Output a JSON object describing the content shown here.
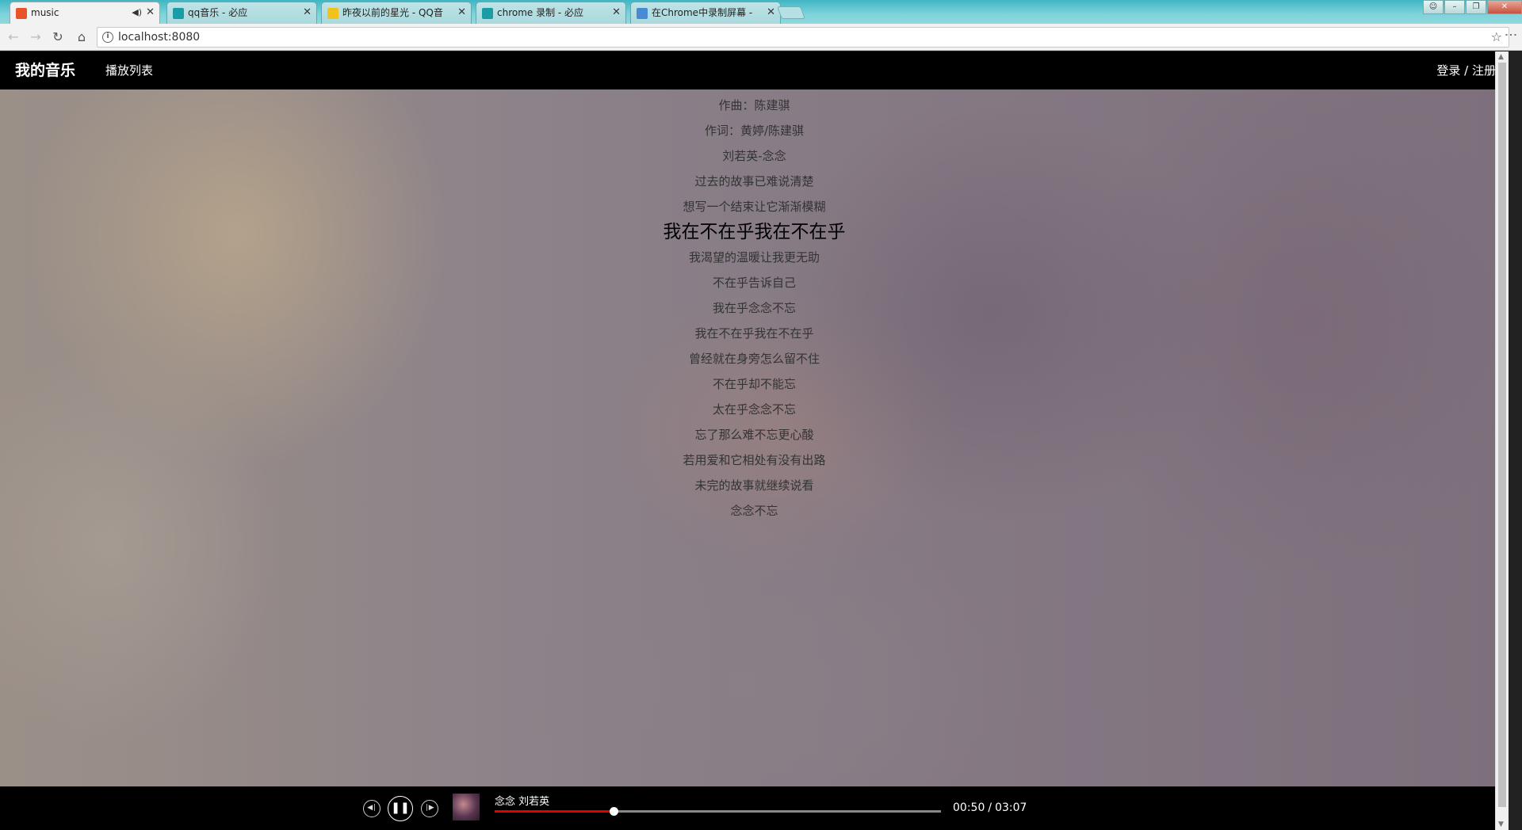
{
  "browser": {
    "tabs": [
      {
        "title": "music",
        "icon": "xampp-icon",
        "icon_color": "#e8532a",
        "active": true,
        "audio": true
      },
      {
        "title": "qq音乐 - 必应",
        "icon": "bing-icon",
        "icon_color": "#1a9ca6"
      },
      {
        "title": "昨夜以前的星光 - QQ音",
        "icon": "qqmusic-icon",
        "icon_color": "#f1c21b"
      },
      {
        "title": "chrome 录制 - 必应",
        "icon": "bing-icon",
        "icon_color": "#1a9ca6"
      },
      {
        "title": "在Chrome中录制屏幕 -",
        "icon": "page-icon",
        "icon_color": "#4a8ad4"
      }
    ],
    "url": "localhost:8080"
  },
  "header": {
    "brand": "我的音乐",
    "nav_playlist": "播放列表",
    "auth": "登录 / 注册"
  },
  "lyrics": [
    {
      "text": "作曲：陈建骐"
    },
    {
      "text": "作词：黄婷/陈建骐"
    },
    {
      "text": "刘若英-念念"
    },
    {
      "text": "过去的故事已难说清楚"
    },
    {
      "text": "想写一个结束让它渐渐模糊"
    },
    {
      "text": "我在不在乎我在不在乎",
      "current": true
    },
    {
      "text": "我渴望的温暖让我更无助"
    },
    {
      "text": "不在乎告诉自己"
    },
    {
      "text": "我在乎念念不忘"
    },
    {
      "text": "我在不在乎我在不在乎"
    },
    {
      "text": "曾经就在身旁怎么留不住"
    },
    {
      "text": "不在乎却不能忘"
    },
    {
      "text": "太在乎念念不忘"
    },
    {
      "text": "忘了那么难不忘更心酸"
    },
    {
      "text": "若用爱和它相处有没有出路"
    },
    {
      "text": "未完的故事就继续说看"
    },
    {
      "text": "念念不忘"
    }
  ],
  "player": {
    "track": "念念 刘若英",
    "current_time": "00:50",
    "duration": "03:07",
    "progress": 0.267,
    "state": "playing",
    "accent": "#e00000"
  }
}
